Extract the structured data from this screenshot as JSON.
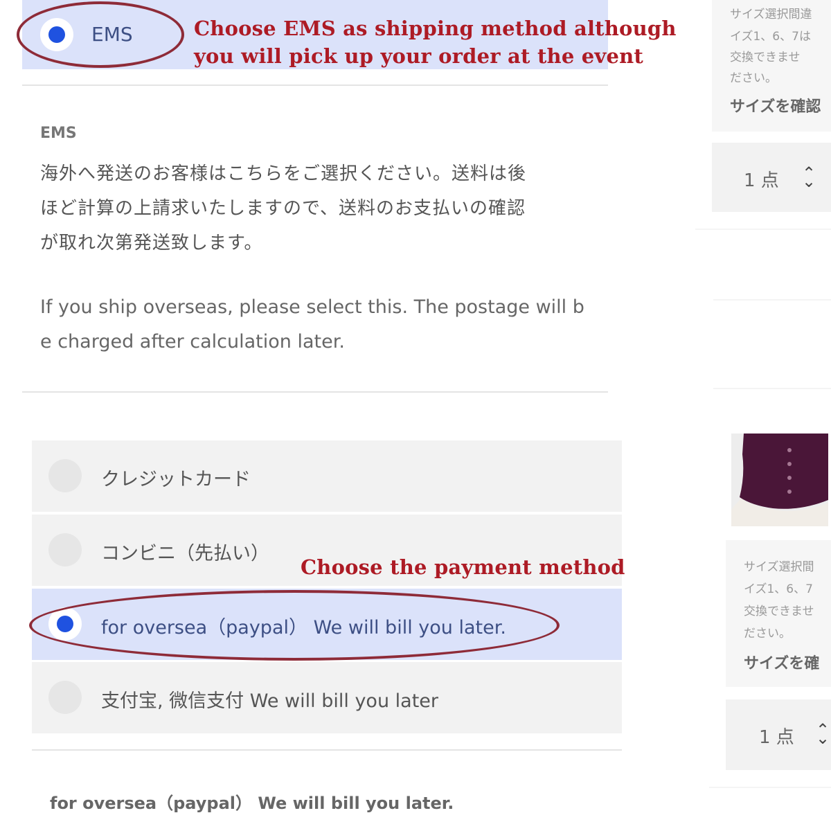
{
  "shipping": {
    "option_label": "EMS",
    "description_heading": "EMS",
    "description_jp": [
      "海外へ発送のお客様はこちらをご選択ください。送料は後",
      "ほど計算の上請求いたしますので、送料のお支払いの確認",
      "が取れ次第発送致します。"
    ],
    "description_en": [
      "If you ship overseas, please select this. The postage will b",
      "e charged after calculation later."
    ]
  },
  "annotations": {
    "shipping_note_line1": "Choose EMS as shipping method although",
    "shipping_note_line2": "you will pick up your order at the event",
    "payment_note": "Choose the payment method",
    "color": "#ad1b25"
  },
  "payment": {
    "options": [
      {
        "label": "クレジットカード",
        "selected": false
      },
      {
        "label": "コンビニ（先払い）",
        "selected": false
      },
      {
        "label": "for oversea（paypal）  We will bill you later.",
        "selected": true
      },
      {
        "label": "支付宝, 微信支付   We will bill you later",
        "selected": false
      }
    ],
    "selected_heading": "for oversea（paypal）  We will bill you later."
  },
  "sidebar": {
    "card1_notes": [
      "サイズ選択間違",
      "イズ1、6、7は",
      "交換できませ",
      "ださい。"
    ],
    "card1_bold": "サイズを確認",
    "card1_qty": "1 点",
    "card2_notes": [
      "サイズ選択間",
      "イズ1、6、7",
      "交換できませ",
      "ださい。"
    ],
    "card2_bold": "サイズを確",
    "card2_qty": "1 点"
  },
  "colors": {
    "selected_bg": "#dbe2fa",
    "radio_dot": "#1f52e0",
    "product_purple": "#4a1638"
  },
  "icons": {
    "radio": "radio-button",
    "spinner": "up-down-spinner-icon"
  }
}
